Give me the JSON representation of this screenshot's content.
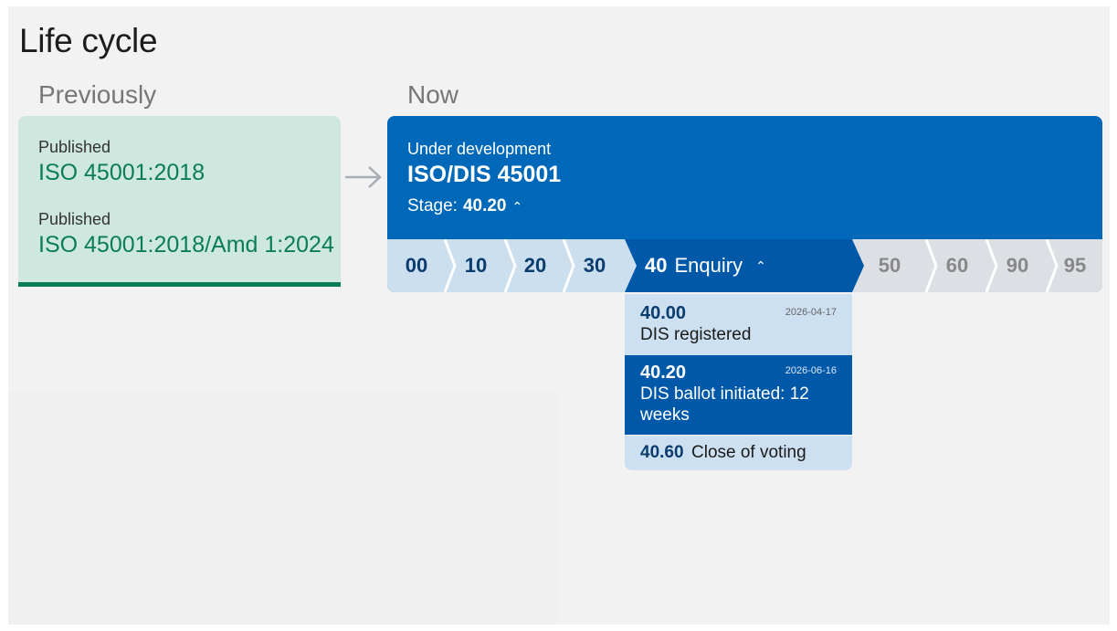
{
  "title": "Life cycle",
  "previously": {
    "heading": "Previously",
    "items": [
      {
        "status": "Published",
        "reference": "ISO 45001:2018"
      },
      {
        "status": "Published",
        "reference": "ISO 45001:2018/Amd 1:2024"
      }
    ]
  },
  "now": {
    "heading": "Now",
    "status": "Under development",
    "reference": "ISO/DIS 45001",
    "stage_label": "Stage:",
    "stage_value": "40.20",
    "stages": [
      {
        "code": "00"
      },
      {
        "code": "10"
      },
      {
        "code": "20"
      },
      {
        "code": "30"
      },
      {
        "code": "40",
        "name": "Enquiry",
        "active": true
      },
      {
        "code": "50"
      },
      {
        "code": "60"
      },
      {
        "code": "90"
      },
      {
        "code": "95"
      }
    ],
    "substages": [
      {
        "code": "40.00",
        "date": "2026-04-17",
        "description": "DIS registered"
      },
      {
        "code": "40.20",
        "date": "2026-06-16",
        "description": "DIS ballot initiated: 12 weeks",
        "current": true
      },
      {
        "code": "40.60",
        "description": "Close of voting"
      }
    ]
  },
  "icons": {
    "arrow": "arrow-right-icon",
    "caret": "caret-up-icon"
  },
  "colors": {
    "published_green": "#0a7d57",
    "published_bg": "#cfe8df",
    "now_blue": "#0068b8",
    "active_stage_blue": "#0059a8",
    "stage_light_blue": "#ccdfef",
    "future_stage_grey": "#dcdfe3"
  }
}
